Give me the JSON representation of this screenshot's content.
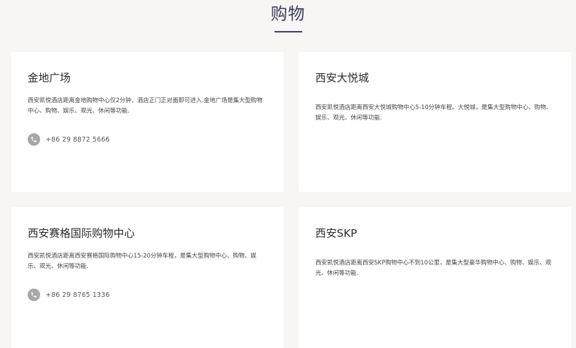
{
  "section": {
    "title": "购物"
  },
  "cards": [
    {
      "title": "金地广场",
      "description": "西安凯悦酒店距离金地购物中心仅2分钟，酒店正门正对面即可进入.金地广场是集大型购物中心、购物、娱乐、观光、休闲等功能.",
      "phone": "+86 29 8872 5666",
      "phone_icon": "phone-icon"
    },
    {
      "title": "西安大悦城",
      "description": "西安凯悦酒店距离西安大悦城购物中心5-10分钟车程。大悦城，是集大型购物中心、购物、娱乐、观光、休闲等功能."
    },
    {
      "title": "西安赛格国际购物中心",
      "description": "西安凯悦酒店距离西安赛格国际购物中心15-20分钟车程，是集大型购物中心、购物、娱乐、观光、休闲等功能.",
      "phone": "+86 29 8765 1336",
      "phone_icon": "phone-icon"
    },
    {
      "title": "西安SKP",
      "description": "西安凯悦酒店距离西安SKP购物中心不到10公里，是集大型豪华购物中心、购物、娱乐、观光、休闲等功能."
    }
  ],
  "colors": {
    "page_background": "#f7f6f4",
    "card_background": "#ffffff",
    "title_accent": "#3d3a5c",
    "icon_background": "#a7a7a7"
  }
}
